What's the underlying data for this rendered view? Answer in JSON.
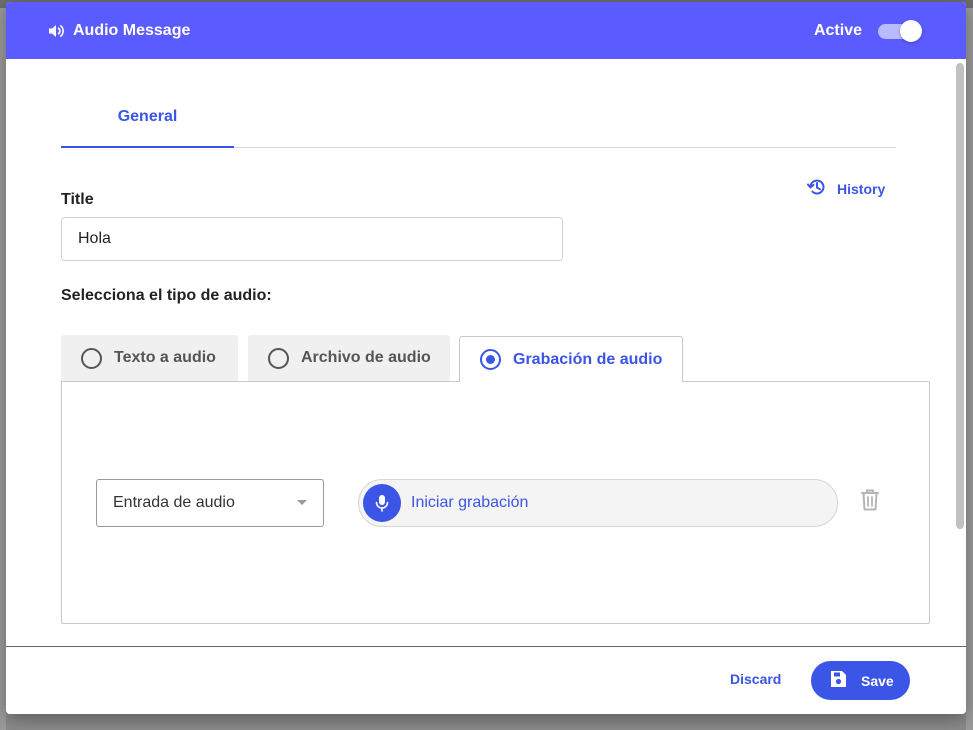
{
  "header": {
    "title": "Audio Message",
    "active_label": "Active",
    "active": true,
    "color": "#5b5cff"
  },
  "tabs": [
    {
      "label": "General",
      "selected": true
    }
  ],
  "history_label": "History",
  "form": {
    "title_label": "Title",
    "title_value": "Hola",
    "audio_type_label": "Selecciona el tipo de audio:"
  },
  "audio_types": [
    {
      "label": "Texto a audio",
      "selected": false
    },
    {
      "label": "Archivo de audio",
      "selected": false
    },
    {
      "label": "Grabación de audio",
      "selected": true
    }
  ],
  "recording": {
    "input_select_value": "Entrada de audio",
    "start_label": "Iniciar grabación"
  },
  "footer": {
    "discard_label": "Discard",
    "save_label": "Save"
  },
  "icons": {
    "header": "speaker-icon",
    "history": "history-icon",
    "mic": "microphone-icon",
    "trash": "trash-icon",
    "save": "floppy-disk-icon"
  },
  "accent_color": "#3b55e6"
}
